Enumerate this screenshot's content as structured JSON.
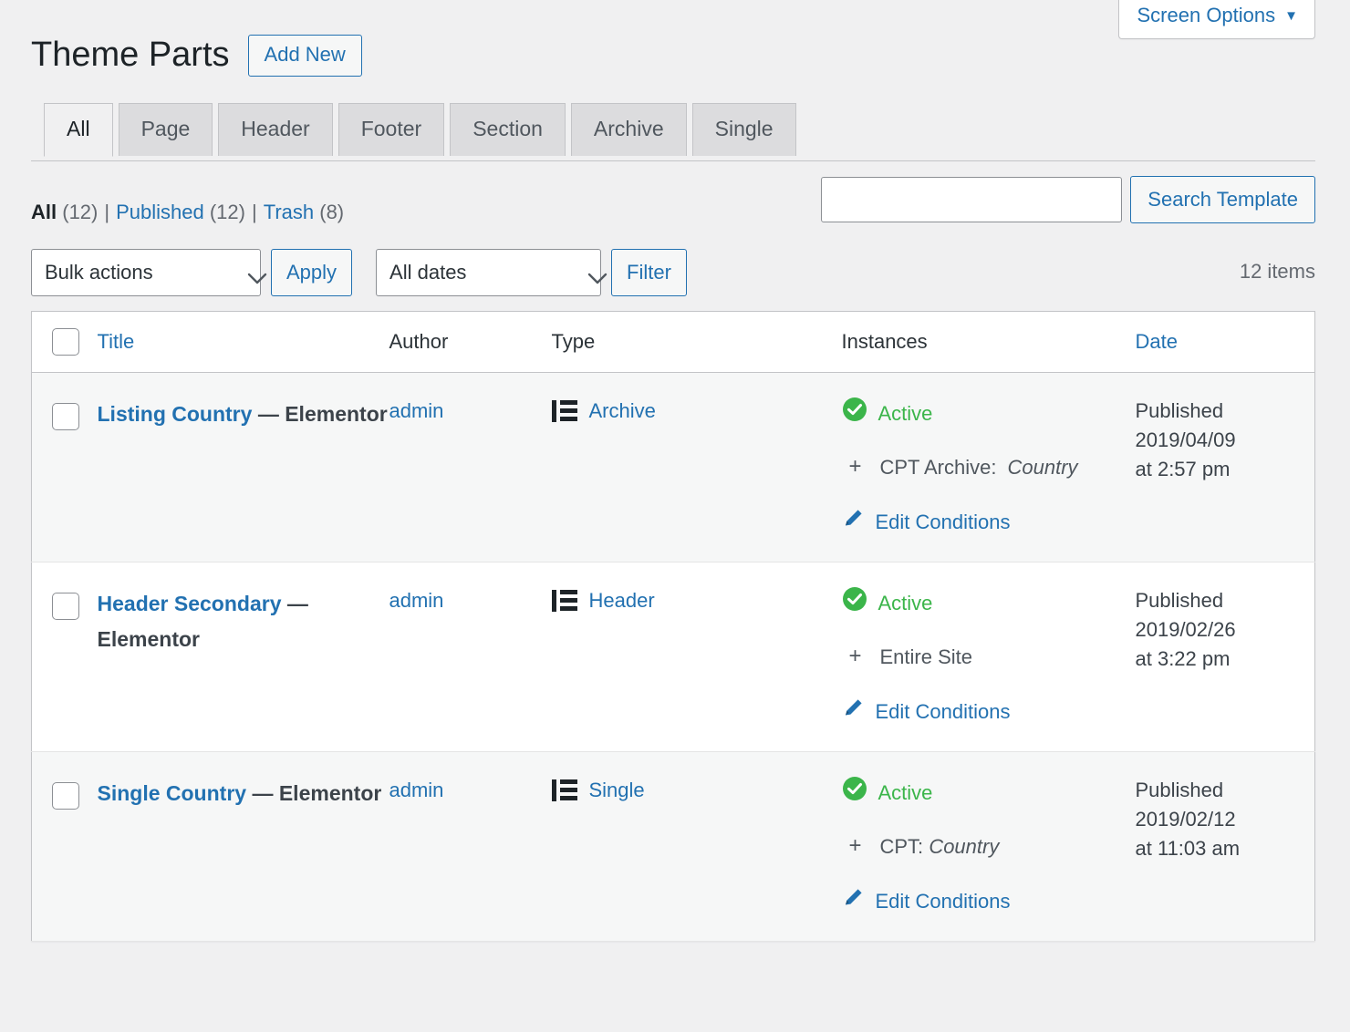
{
  "screen_options": {
    "label": "Screen Options",
    "caret": "▼"
  },
  "header": {
    "title": "Theme Parts",
    "add_new_label": "Add New"
  },
  "tabs": [
    {
      "label": "All",
      "active": true
    },
    {
      "label": "Page",
      "active": false
    },
    {
      "label": "Header",
      "active": false
    },
    {
      "label": "Footer",
      "active": false
    },
    {
      "label": "Section",
      "active": false
    },
    {
      "label": "Archive",
      "active": false
    },
    {
      "label": "Single",
      "active": false
    }
  ],
  "status_links": [
    {
      "label": "All",
      "count": "(12)",
      "current": true
    },
    {
      "label": "Published",
      "count": "(12)",
      "current": false
    },
    {
      "label": "Trash",
      "count": "(8)",
      "current": false
    }
  ],
  "separator": "|",
  "search": {
    "value": "",
    "placeholder": "",
    "button_label": "Search Template"
  },
  "tablenav": {
    "bulk_actions_selected": "Bulk actions",
    "apply_label": "Apply",
    "dates_selected": "All dates",
    "filter_label": "Filter",
    "displaying_num": "12 items"
  },
  "columns": [
    {
      "key": "cb",
      "label": ""
    },
    {
      "key": "title",
      "label": "Title",
      "sortable": true
    },
    {
      "key": "author",
      "label": "Author",
      "sortable": false
    },
    {
      "key": "type",
      "label": "Type",
      "sortable": false
    },
    {
      "key": "instances",
      "label": "Instances",
      "sortable": false
    },
    {
      "key": "date",
      "label": "Date",
      "sortable": true
    }
  ],
  "rows": [
    {
      "title": "Listing Country ",
      "title_suffix": "— Elementor",
      "author": "admin",
      "type": "Archive",
      "type_icon": "archive-list-icon",
      "status": "Active",
      "conditions": [
        {
          "key": "CPT Archive:",
          "name": "Country"
        }
      ],
      "edit_conditions_label": "Edit Conditions",
      "date_status": "Published",
      "date": "2019/04/09",
      "time": "at 2:57 pm"
    },
    {
      "title": "Header Secondary ",
      "title_suffix": "— Elementor",
      "author": "admin",
      "type": "Header",
      "type_icon": "archive-list-icon",
      "status": "Active",
      "conditions": [
        {
          "key": "Entire Site",
          "name": ""
        }
      ],
      "edit_conditions_label": "Edit Conditions",
      "date_status": "Published",
      "date": "2019/02/26",
      "time": "at 3:22 pm"
    },
    {
      "title": "Single Country ",
      "title_suffix": "— Elementor",
      "author": "admin",
      "type": "Single",
      "type_icon": "archive-list-icon",
      "status": "Active",
      "conditions": [
        {
          "key": "CPT:",
          "name": "Country"
        }
      ],
      "edit_conditions_label": "Edit Conditions",
      "date_status": "Published",
      "date": "2019/02/12",
      "time": "at 11:03 am"
    }
  ],
  "colors": {
    "link": "#2271b1",
    "active_green": "#3bb54a",
    "page_bg": "#f0f0f1",
    "row_alt": "#f6f7f7",
    "border": "#c3c4c7"
  }
}
